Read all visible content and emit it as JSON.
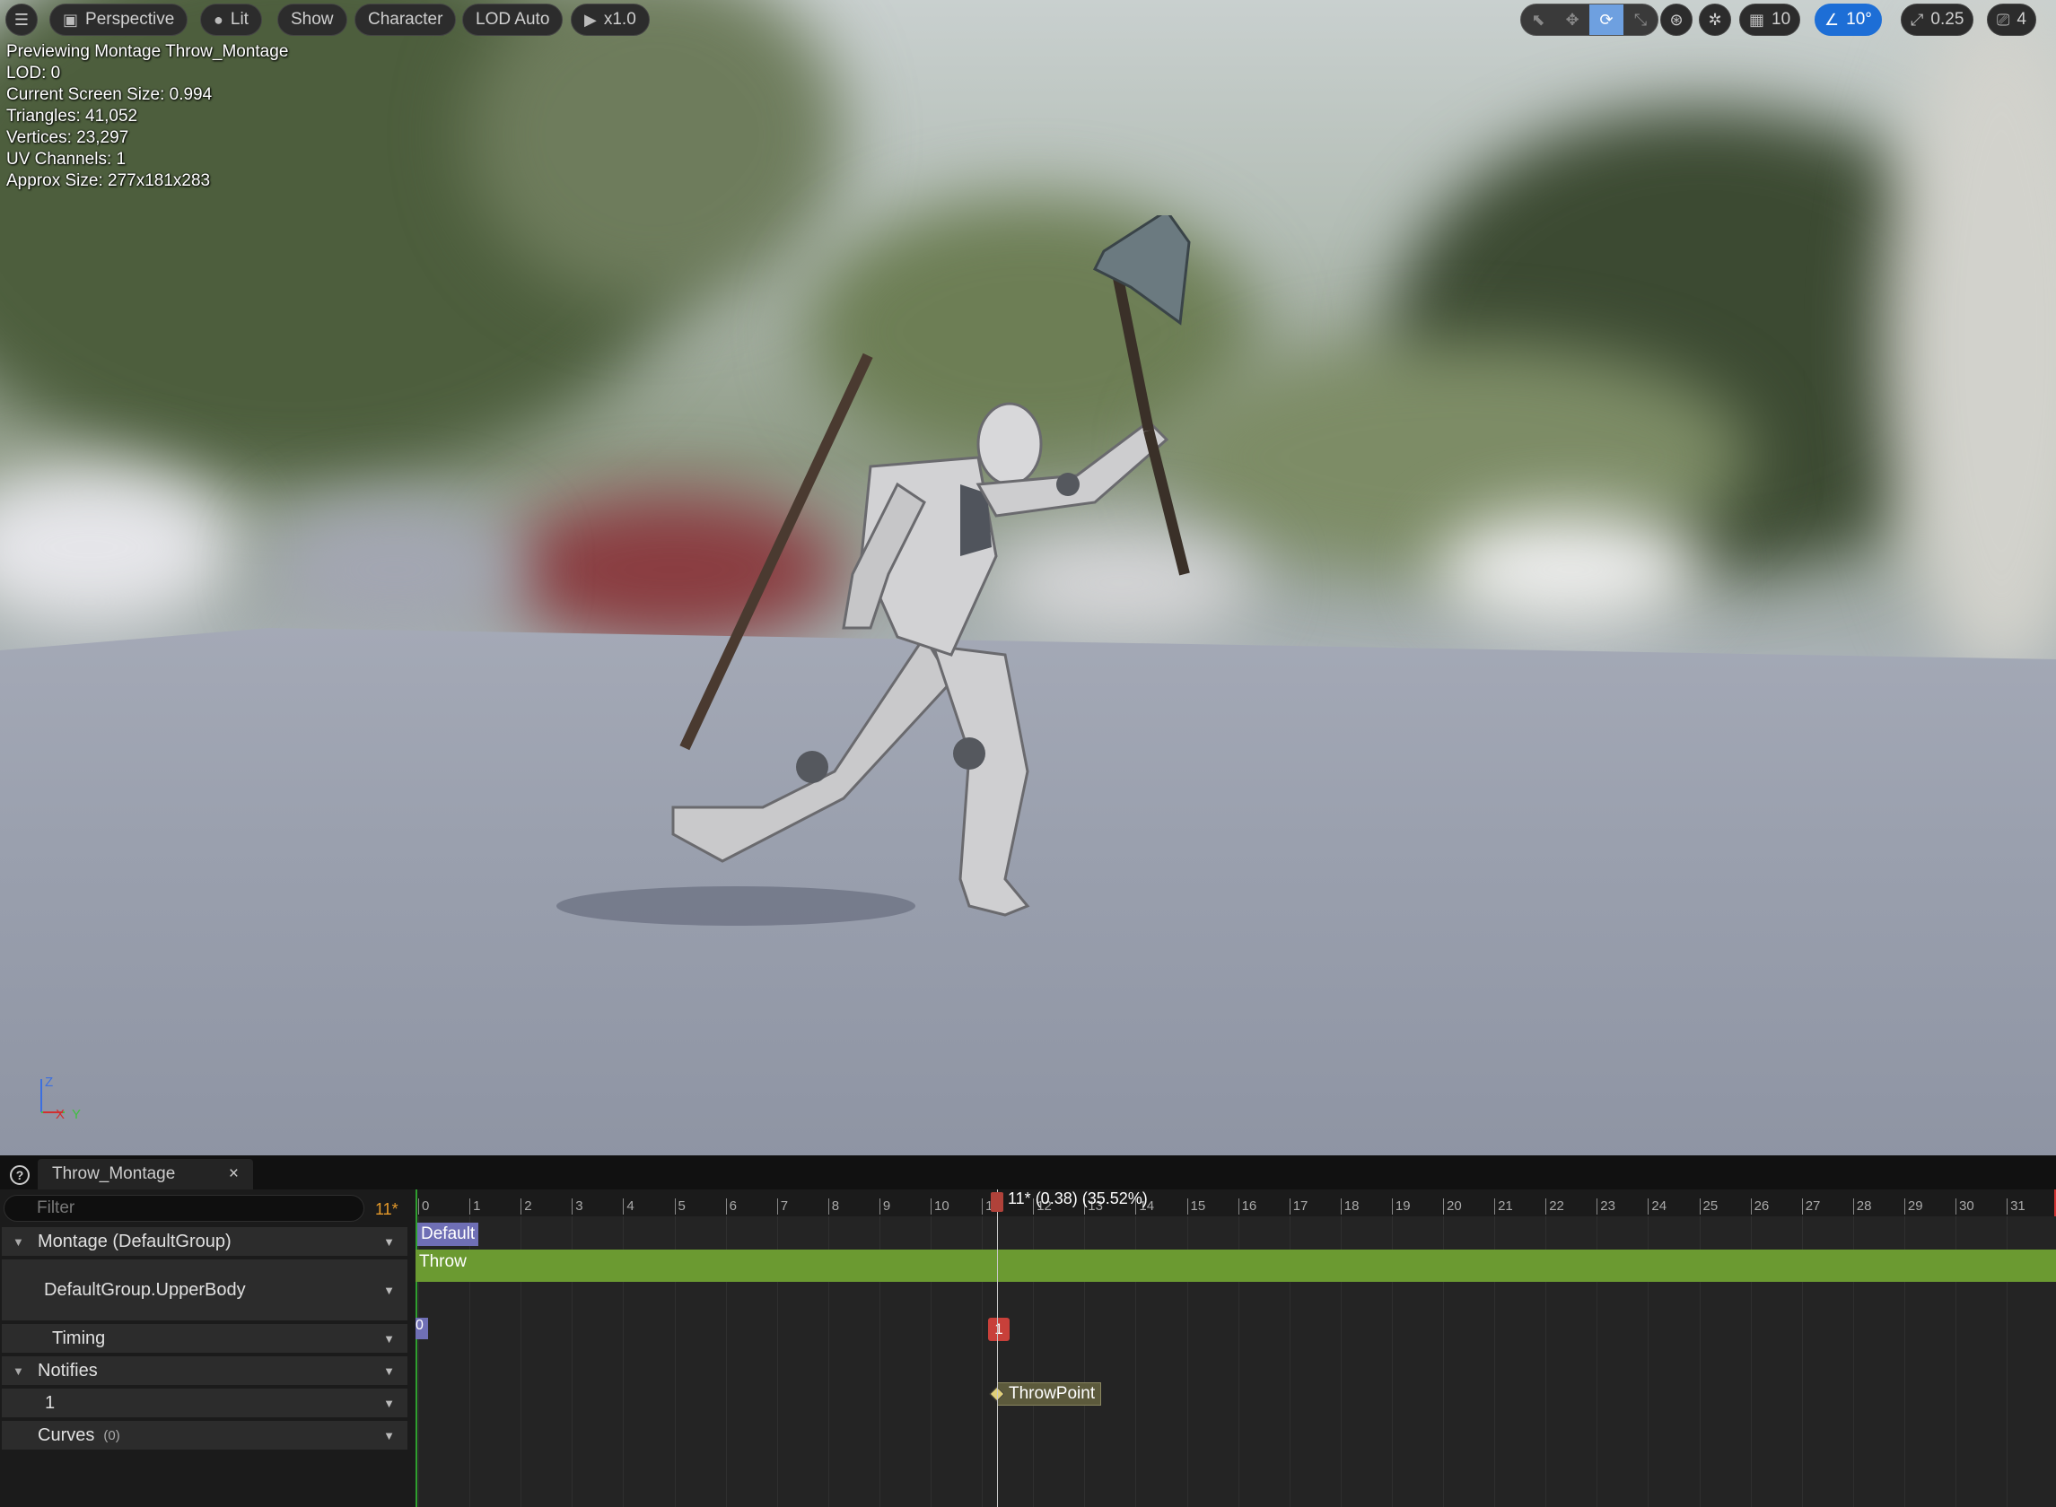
{
  "viewport": {
    "toolbar": {
      "menu_icon": "hamburger-icon",
      "perspective": "Perspective",
      "lit": "Lit",
      "show": "Show",
      "character": "Character",
      "lod": "LOD Auto",
      "play_speed": "x1.0",
      "grid_snap": "10",
      "rotation_snap": "10°",
      "scale_snap": "0.25",
      "camera_speed": "4"
    },
    "stats": [
      "Previewing Montage Throw_Montage",
      "LOD: 0",
      "Current Screen Size: 0.994",
      "Triangles: 41,052",
      "Vertices: 23,297",
      "UV Channels: 1",
      "Approx Size: 277x181x283"
    ],
    "axis": {
      "z": "Z",
      "x": "X",
      "y": "Y"
    }
  },
  "panel": {
    "tab_title": "Throw_Montage",
    "tab_close": "×",
    "filter_placeholder": "Filter",
    "current_frame": "11*",
    "tree": {
      "montage": "Montage (DefaultGroup)",
      "slot": "DefaultGroup.UpperBody",
      "timing": "Timing",
      "notifies": "Notifies",
      "notify_track": "1",
      "curves": "Curves",
      "curves_count": "(0)"
    },
    "timeline": {
      "ticks": [
        "0",
        "1",
        "2",
        "3",
        "4",
        "5",
        "6",
        "7",
        "8",
        "9",
        "10",
        "11",
        "12",
        "13",
        "14",
        "15",
        "16",
        "17",
        "18",
        "19",
        "20",
        "21",
        "22",
        "23",
        "24",
        "25",
        "26",
        "27",
        "28",
        "29",
        "30",
        "31"
      ],
      "playhead_label": "11* (0.38) (35.52%)",
      "section": "Default",
      "segment": "Throw",
      "timing_start": "0",
      "timing_marker": "1",
      "notify": "ThrowPoint"
    }
  }
}
